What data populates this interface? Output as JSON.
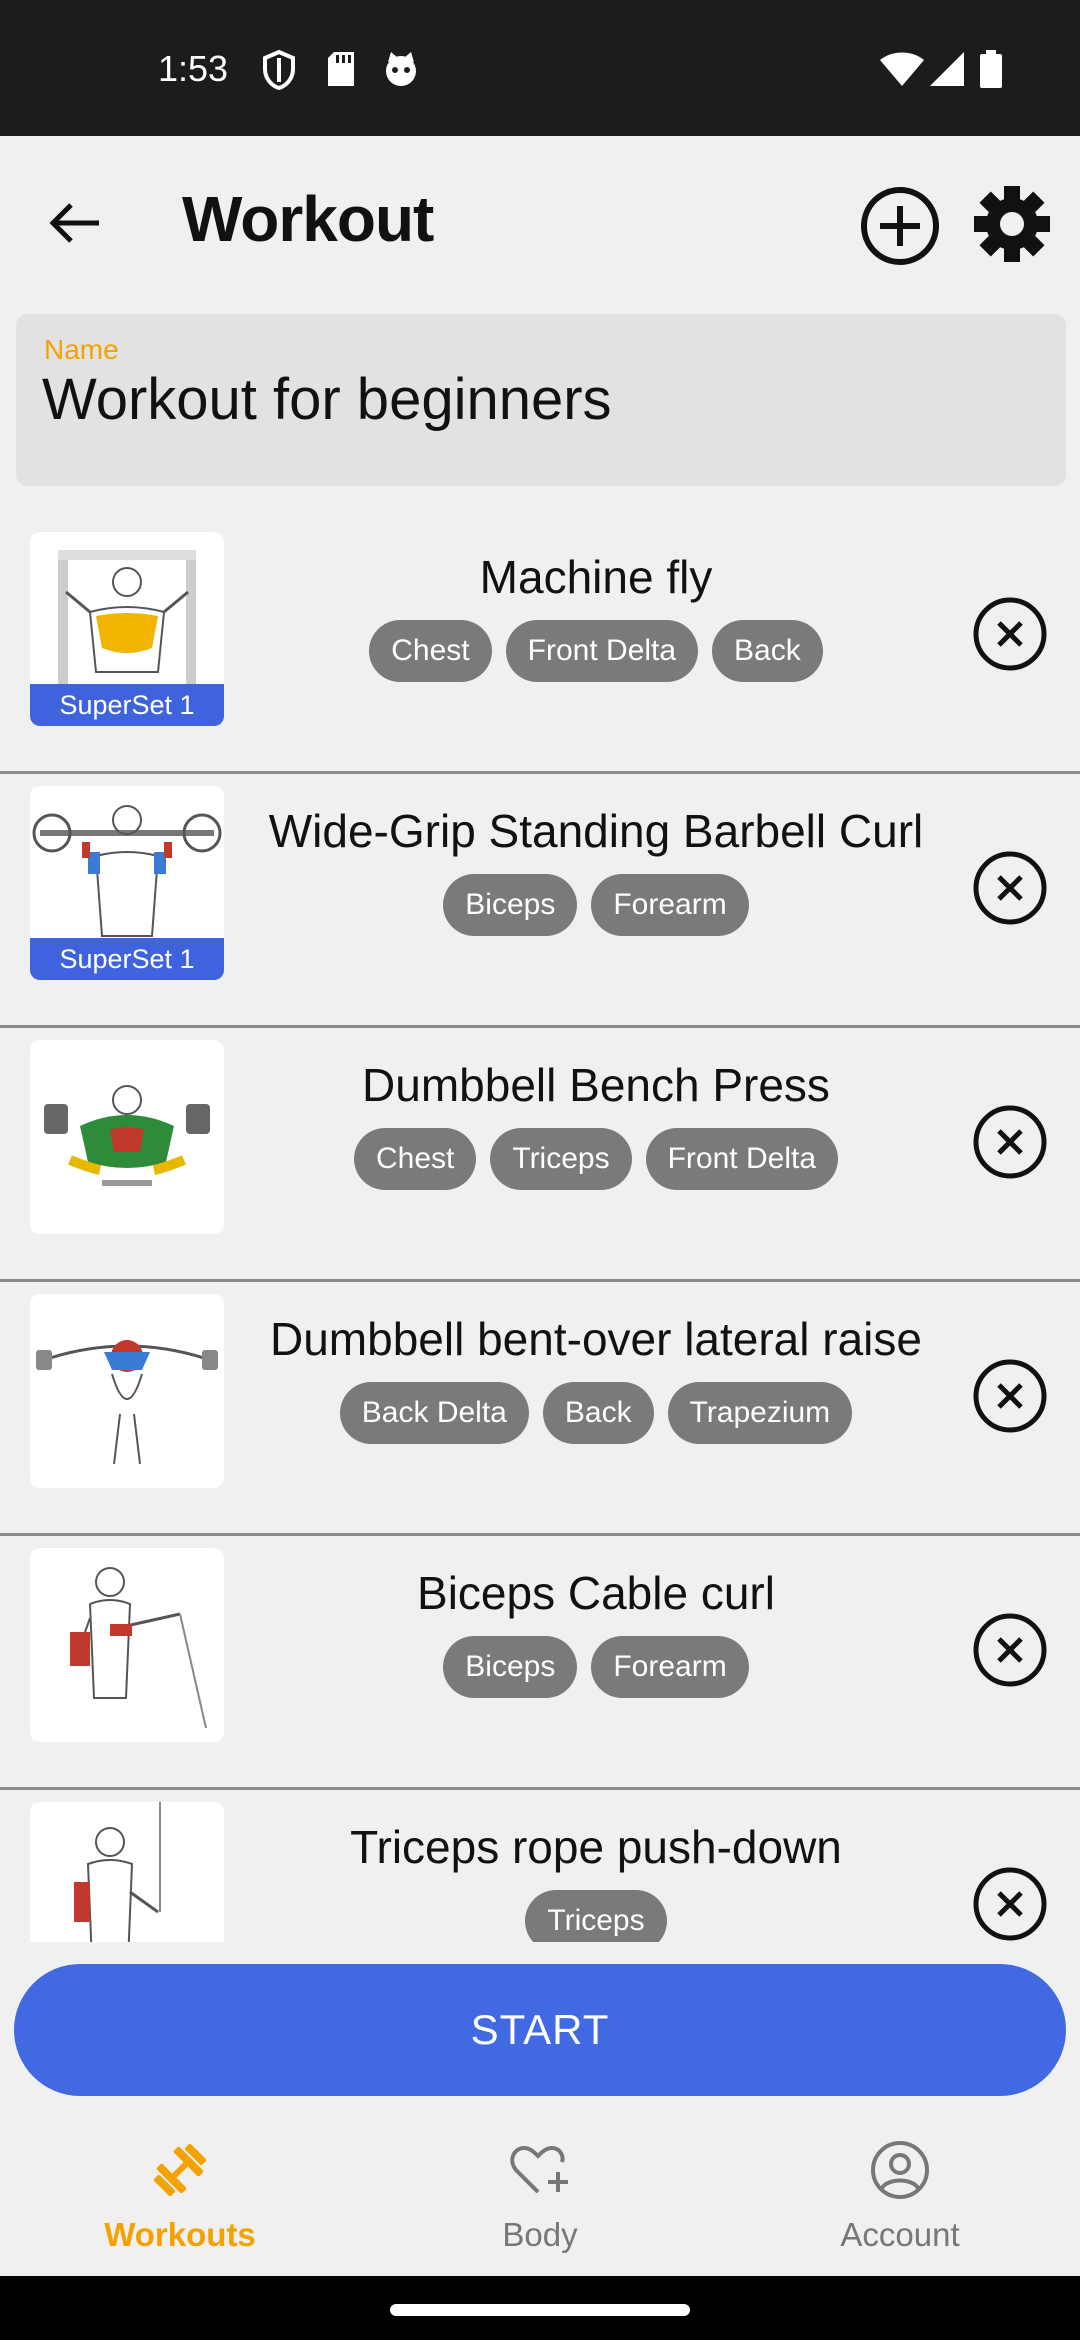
{
  "status_bar": {
    "time": "1:53",
    "left_icons": [
      "shield-icon",
      "sd-card-icon",
      "cat-face-icon"
    ],
    "right_icons": [
      "wifi-icon",
      "cell-signal-icon",
      "battery-icon"
    ]
  },
  "header": {
    "title": "Workout",
    "back_icon": "back-arrow-icon",
    "add_icon": "add-circle-icon",
    "settings_icon": "gear-icon"
  },
  "name_field": {
    "label": "Name",
    "value": "Workout for beginners"
  },
  "exercises": [
    {
      "name": "Machine fly",
      "tags": [
        "Chest",
        "Front Delta",
        "Back"
      ],
      "superset": "SuperSet 1",
      "image": "machine-fly-illustration"
    },
    {
      "name": "Wide-Grip Standing Barbell Curl",
      "tags": [
        "Biceps",
        "Forearm"
      ],
      "superset": "SuperSet 1",
      "image": "barbell-curl-illustration"
    },
    {
      "name": "Dumbbell Bench Press",
      "tags": [
        "Chest",
        "Triceps",
        "Front Delta"
      ],
      "superset": "",
      "image": "bench-press-illustration"
    },
    {
      "name": "Dumbbell bent-over lateral raise",
      "tags": [
        "Back Delta",
        "Back",
        "Trapezium"
      ],
      "superset": "",
      "image": "lateral-raise-illustration"
    },
    {
      "name": "Biceps Cable curl",
      "tags": [
        "Biceps",
        "Forearm"
      ],
      "superset": "",
      "image": "cable-curl-illustration"
    },
    {
      "name": "Triceps rope push-down",
      "tags": [
        "Triceps"
      ],
      "superset": "",
      "image": "rope-pushdown-illustration"
    }
  ],
  "start_button": {
    "label": "START"
  },
  "bottom_nav": [
    {
      "label": "Workouts",
      "icon": "dumbbell-icon",
      "active": true
    },
    {
      "label": "Body",
      "icon": "heart-plus-icon",
      "active": false
    },
    {
      "label": "Account",
      "icon": "account-circle-icon",
      "active": false
    }
  ],
  "colors": {
    "accent": "#f5a100",
    "primary": "#4169e1",
    "superset_badge": "#3e63dd",
    "tag_background": "#7a7a7a",
    "background": "#f0f0f0"
  }
}
